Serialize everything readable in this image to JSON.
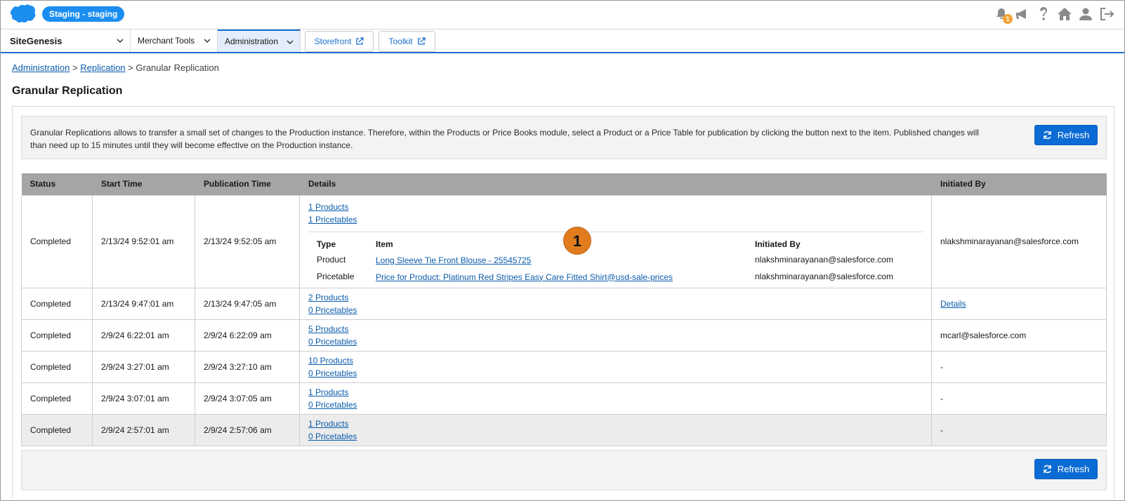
{
  "header": {
    "environment": "Staging - staging",
    "notification_count": "1"
  },
  "nav": {
    "site": "SiteGenesis",
    "merchant_tools": "Merchant Tools",
    "administration": "Administration",
    "storefront": "Storefront",
    "toolkit": "Toolkit"
  },
  "breadcrumb": {
    "level1": "Administration",
    "level2": "Replication",
    "current": "Granular Replication",
    "sep": ">"
  },
  "page": {
    "title": "Granular Replication",
    "info": "Granular Replications allows to transfer a small set of changes to the Production instance. Therefore, within the Products or Price Books module, select a Product or a Price Table for publication by clicking the button next to the item. Published changes will than need up to 15 minutes until they will become effective on the Production instance.",
    "refresh_label": "Refresh",
    "marker": "1"
  },
  "table": {
    "headers": {
      "status": "Status",
      "start_time": "Start Time",
      "publication_time": "Publication Time",
      "details": "Details",
      "initiated_by": "Initiated By"
    },
    "rows": [
      {
        "status": "Completed",
        "start": "2/13/24  9:52:01 am",
        "pub": "2/13/24  9:52:05 am",
        "products": "1 Products",
        "pricetables": "1 Pricetables",
        "initiated": "nlakshminarayanan@salesforce.com",
        "expanded": {
          "col_type": "Type",
          "col_item": "Item",
          "col_initiated": "Initiated By",
          "items": [
            {
              "type": "Product",
              "item": "Long Sleeve Tie Front Blouse - 25545725",
              "initiated": "nlakshminarayanan@salesforce.com"
            },
            {
              "type": "Pricetable",
              "item": "Price for Product: Platinum Red Stripes Easy Care Fitted Shirt@usd-sale-prices",
              "initiated": "nlakshminarayanan@salesforce.com"
            }
          ]
        }
      },
      {
        "status": "Completed",
        "start": "2/13/24  9:47:01 am",
        "pub": "2/13/24  9:47:05 am",
        "products": "2 Products",
        "pricetables": "0 Pricetables",
        "initiated": "Details"
      },
      {
        "status": "Completed",
        "start": "2/9/24  6:22:01 am",
        "pub": "2/9/24  6:22:09 am",
        "products": "5 Products",
        "pricetables": "0 Pricetables",
        "initiated": "mcarl@salesforce.com"
      },
      {
        "status": "Completed",
        "start": "2/9/24  3:27:01 am",
        "pub": "2/9/24  3:27:10 am",
        "products": "10 Products",
        "pricetables": "0 Pricetables",
        "initiated": "-"
      },
      {
        "status": "Completed",
        "start": "2/9/24  3:07:01 am",
        "pub": "2/9/24  3:07:05 am",
        "products": "1 Products",
        "pricetables": "0 Pricetables",
        "initiated": "-"
      },
      {
        "status": "Completed",
        "start": "2/9/24  2:57:01 am",
        "pub": "2/9/24  2:57:06 am",
        "products": "1 Products",
        "pricetables": "0 Pricetables",
        "initiated": "-"
      }
    ]
  },
  "icons": [
    "salesforce-cloud-icon",
    "bell-icon",
    "megaphone-icon",
    "help-icon",
    "home-icon",
    "user-icon",
    "logout-icon",
    "chevron-down-icon",
    "external-link-icon",
    "refresh-icon"
  ],
  "colors": {
    "brand_blue": "#0b6bd4",
    "badge_blue": "#1b8ef0",
    "marker_orange": "#e07c1e",
    "header_gray": "#a5a5a5"
  }
}
